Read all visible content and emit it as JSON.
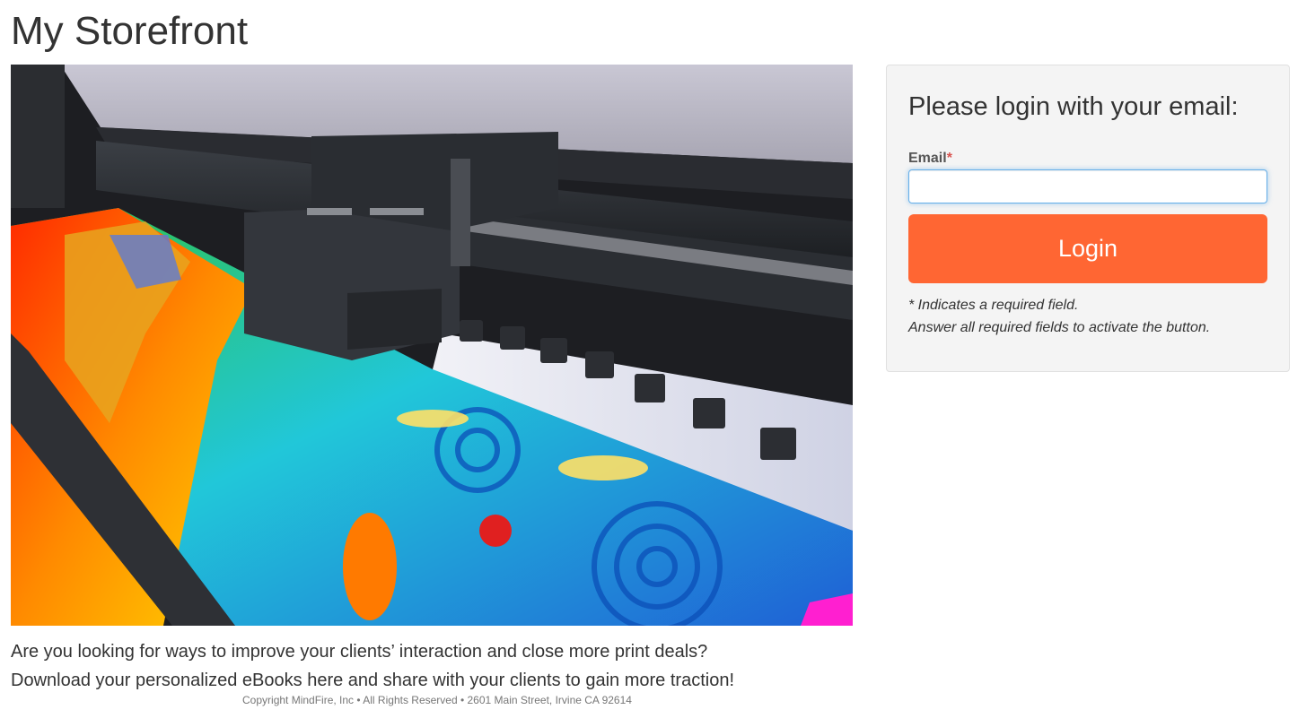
{
  "page": {
    "title": "My Storefront"
  },
  "hero": {
    "image_alt": "Large format inkjet printer printing a colorful koi fish banner"
  },
  "promo": {
    "line1": "Are you looking for ways to improve your clients’ interaction and close more print deals?",
    "line2": "Download your personalized eBooks here and share with your clients to gain more traction!"
  },
  "footer": {
    "text": "Copyright MindFire, Inc • All Rights Reserved • 2601 Main Street, Irvine CA 92614"
  },
  "login": {
    "heading": "Please login with your email:",
    "email_label": "Email",
    "required_marker": "*",
    "email_value": "",
    "button_label": "Login",
    "note_line1": "* Indicates a required field.",
    "note_line2": "Answer all required fields to activate the button."
  },
  "colors": {
    "accent": "#ff6633",
    "panel_bg": "#f4f4f4",
    "required": "#d9534f"
  }
}
